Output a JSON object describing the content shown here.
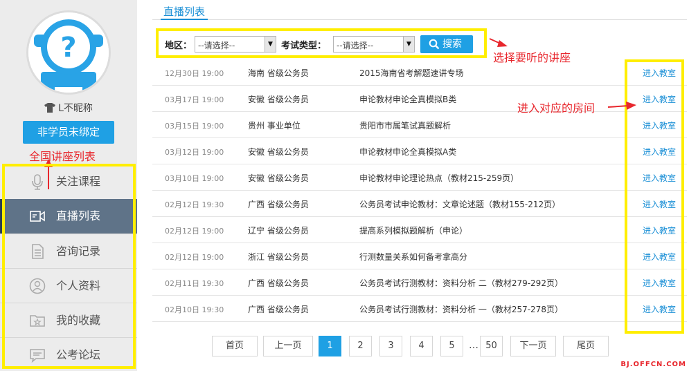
{
  "sidebar": {
    "nickname": "L不昵称",
    "bind_label": "非学员未绑定",
    "annotation": "全国讲座列表",
    "menu": [
      {
        "label": "关注课程",
        "icon": "microphone-icon",
        "active": false
      },
      {
        "label": "直播列表",
        "icon": "video-icon",
        "active": true
      },
      {
        "label": "咨询记录",
        "icon": "document-icon",
        "active": false
      },
      {
        "label": "个人资料",
        "icon": "user-icon",
        "active": false
      },
      {
        "label": "我的收藏",
        "icon": "favorites-folder-icon",
        "active": false
      },
      {
        "label": "公考论坛",
        "icon": "chat-bubble-icon",
        "active": false
      }
    ]
  },
  "tabs": {
    "active": "直播列表"
  },
  "filter": {
    "region_label": "地区：",
    "region_value": "--请选择--",
    "type_label": "考试类型：",
    "type_value": "--请选择--",
    "search_label": "搜索"
  },
  "annotations": {
    "select_lecture": "选择要听的讲座",
    "enter_room": "进入对应的房间"
  },
  "rows": [
    {
      "date": "12月30日 19:00",
      "region": "海南 省级公务员",
      "title": "2015海南省考解题速讲专场",
      "enter": "进入教室"
    },
    {
      "date": "03月17日 19:00",
      "region": "安徽 省级公务员",
      "title": "申论教材申论全真模拟B类",
      "enter": "进入教室"
    },
    {
      "date": "03月15日 19:00",
      "region": "贵州 事业单位",
      "title": "贵阳市市属笔试真题解析",
      "enter": "进入教室"
    },
    {
      "date": "03月12日 19:00",
      "region": "安徽 省级公务员",
      "title": "申论教材申论全真模拟A类",
      "enter": "进入教室"
    },
    {
      "date": "03月10日 19:00",
      "region": "安徽 省级公务员",
      "title": "申论教材申论理论热点（教材215-259页）",
      "enter": "进入教室"
    },
    {
      "date": "02月12日 19:30",
      "region": "广西 省级公务员",
      "title": "公务员考试申论教材：文章论述题（教材155-212页）",
      "enter": "进入教室"
    },
    {
      "date": "02月12日 19:00",
      "region": "辽宁 省级公务员",
      "title": "提高系列模拟题解析（申论）",
      "enter": "进入教室"
    },
    {
      "date": "02月12日 19:00",
      "region": "浙江 省级公务员",
      "title": "行测数量关系如何备考拿高分",
      "enter": "进入教室"
    },
    {
      "date": "02月11日 19:30",
      "region": "广西 省级公务员",
      "title": "公务员考试行测教材：资料分析 二（教材279-292页）",
      "enter": "进入教室"
    },
    {
      "date": "02月10日 19:30",
      "region": "广西 省级公务员",
      "title": "公务员考试行测教材：资料分析 一（教材257-278页）",
      "enter": "进入教室"
    }
  ],
  "pager": {
    "first": "首页",
    "prev": "上一页",
    "pages": [
      "1",
      "2",
      "3",
      "4",
      "5"
    ],
    "current": "1",
    "ellipsis": "…",
    "last_page": "50",
    "next": "下一页",
    "end": "尾页"
  },
  "watermark": "BJ.OFFCN.COM",
  "colors": {
    "accent": "#1fa0e4",
    "highlight": "#ffee00",
    "annotation": "#e8272d",
    "active_menu": "#5f7388"
  }
}
